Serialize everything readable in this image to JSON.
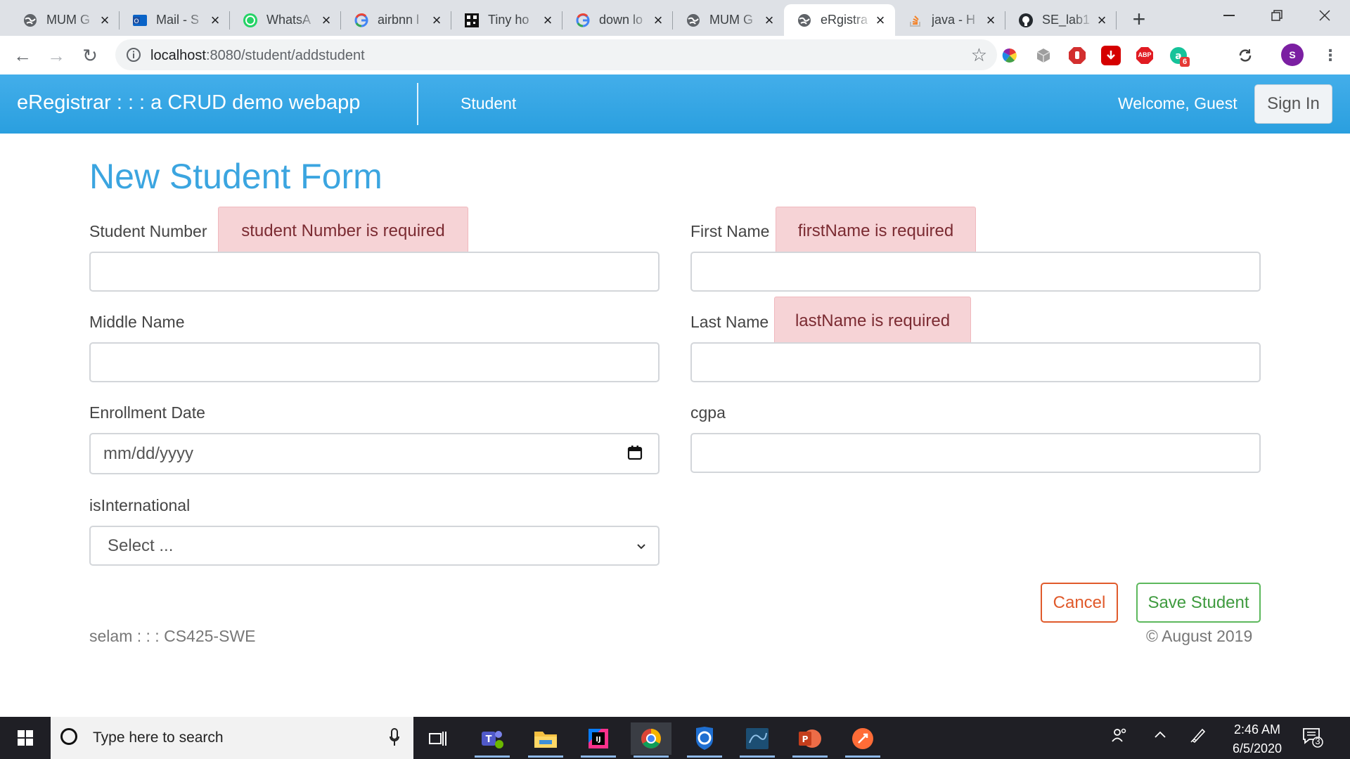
{
  "browser": {
    "tabs": [
      {
        "title": "MUM G",
        "icon": "globe-icon"
      },
      {
        "title": "Mail - S",
        "icon": "outlook-icon"
      },
      {
        "title": "WhatsA",
        "icon": "whatsapp-icon"
      },
      {
        "title": "airbnn l",
        "icon": "google-icon"
      },
      {
        "title": "Tiny ho",
        "icon": "qr-icon"
      },
      {
        "title": "down lo",
        "icon": "google-icon"
      },
      {
        "title": "MUM G",
        "icon": "globe-icon"
      },
      {
        "title": "eRgistra",
        "icon": "globe-icon",
        "active": true
      },
      {
        "title": "java - H",
        "icon": "stackoverflow-icon"
      },
      {
        "title": "SE_lab1",
        "icon": "github-icon"
      }
    ],
    "url_host": "localhost",
    "url_rest": ":8080/student/addstudent",
    "profile_initial": "S",
    "extension_badge": "6",
    "abp_label": "ABP"
  },
  "navbar": {
    "brand": "eRegistrar : : : a CRUD demo webapp",
    "link_student": "Student",
    "welcome": "Welcome, Guest",
    "signin": "Sign In"
  },
  "form": {
    "title": "New Student Form",
    "student_number_label": "Student Number",
    "student_number_error": "student Number is required",
    "first_name_label": "First Name",
    "first_name_error": "firstName is required",
    "middle_name_label": "Middle Name",
    "last_name_label": "Last Name",
    "last_name_error": "lastName is required",
    "enrollment_date_label": "Enrollment Date",
    "enrollment_date_placeholder": "mm/dd/yyyy",
    "cgpa_label": "cgpa",
    "is_international_label": "isInternational",
    "is_international_selected": "Select ...",
    "cancel": "Cancel",
    "save": "Save Student"
  },
  "footer": {
    "left": "selam : : : CS425-SWE",
    "right": "© August 2019"
  },
  "taskbar": {
    "search_placeholder": "Type here to search",
    "time": "2:46 AM",
    "date": "6/5/2020",
    "notification_count": "3"
  }
}
